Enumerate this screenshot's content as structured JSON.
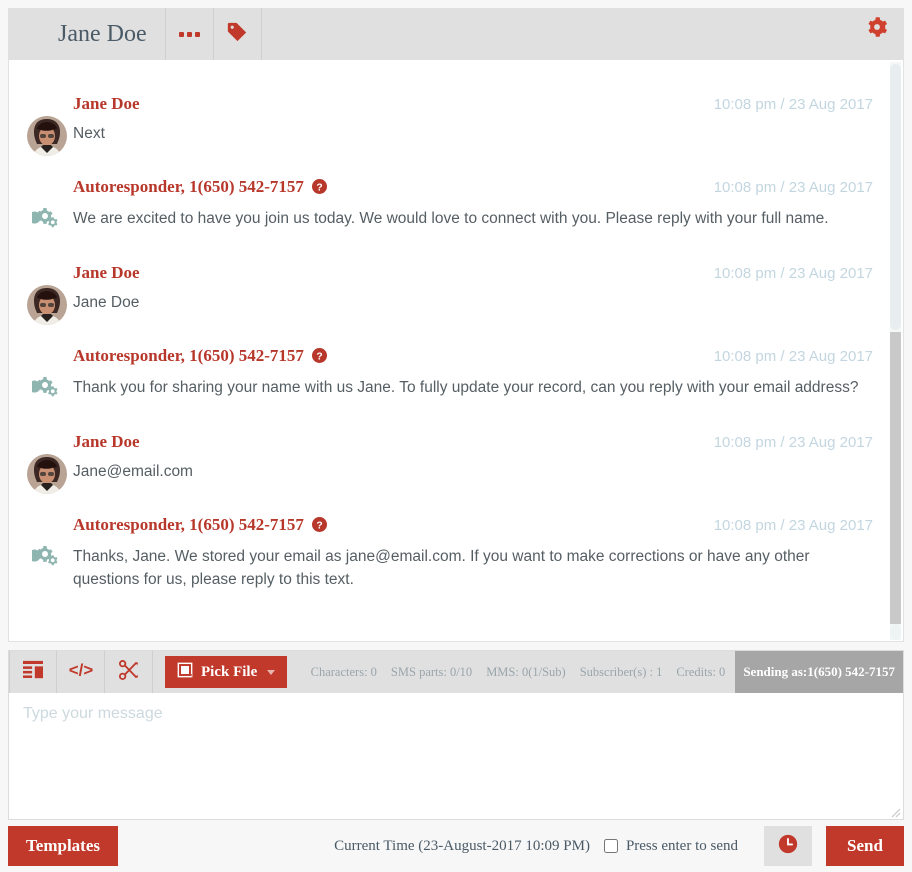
{
  "header": {
    "contact_name": "Jane Doe",
    "more_icon": "ellipsis-icon",
    "tag_icon": "tag-icon",
    "settings_icon": "gear-icon"
  },
  "conversation": {
    "messages": [
      {
        "sender": "Jane Doe",
        "sender_type": "contact",
        "has_help_icon": false,
        "timestamp": "10:08 pm / 23 Aug 2017",
        "body": "Next"
      },
      {
        "sender": "Autoresponder, 1(650) 542-7157",
        "sender_type": "autoresponder",
        "has_help_icon": true,
        "timestamp": "10:08 pm / 23 Aug 2017",
        "body": "We are excited to have you join us today. We would love to connect with you. Please reply with your full name."
      },
      {
        "sender": "Jane Doe",
        "sender_type": "contact",
        "has_help_icon": false,
        "timestamp": "10:08 pm / 23 Aug 2017",
        "body": "Jane Doe"
      },
      {
        "sender": "Autoresponder, 1(650) 542-7157",
        "sender_type": "autoresponder",
        "has_help_icon": true,
        "timestamp": "10:08 pm / 23 Aug 2017",
        "body": "Thank you for sharing your name with us Jane. To fully update your record, can you reply with your email address?"
      },
      {
        "sender": "Jane Doe",
        "sender_type": "contact",
        "has_help_icon": false,
        "timestamp": "10:08 pm / 23 Aug 2017",
        "body": "Jane@email.com"
      },
      {
        "sender": "Autoresponder, 1(650) 542-7157",
        "sender_type": "autoresponder",
        "has_help_icon": true,
        "timestamp": "10:08 pm / 23 Aug 2017",
        "body": "Thanks, Jane. We stored your email as jane@email.com. If you want to make corrections or have any other questions for us, please reply to this text."
      }
    ]
  },
  "composer": {
    "toolbar": {
      "template_icon": "insert-template-icon",
      "code_icon": "code-icon",
      "shortcode_icon": "scissors-icon",
      "pick_file_label": "Pick File",
      "pick_file_icon": "file-icon"
    },
    "stats": {
      "characters": "Characters: 0",
      "sms_parts": "SMS parts: 0/10",
      "mms": "MMS: 0(1/Sub)",
      "subscribers": "Subscriber(s) : 1",
      "credits": "Credits: 0",
      "sending_as": "Sending as:1(650) 542-7157"
    },
    "input": {
      "value": "",
      "placeholder": "Type your message"
    }
  },
  "bottom": {
    "templates_label": "Templates",
    "current_time": "Current Time (23-August-2017 10:09 PM)",
    "press_enter_label": "Press enter to send",
    "press_enter_checked": false,
    "schedule_icon": "clock-icon",
    "send_label": "Send"
  },
  "colors": {
    "accent_red": "#c0392b",
    "sender_red": "#b8372b",
    "timestamp_blue": "#c3d6e0",
    "header_gray": "#e0e0e0",
    "autoresponder_teal": "#8fb5b0",
    "body_text": "#555e63"
  }
}
